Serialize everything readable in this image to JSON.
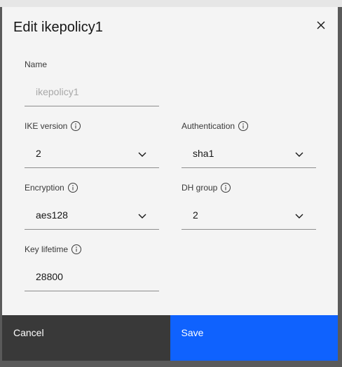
{
  "modal": {
    "title": "Edit ikepolicy1"
  },
  "fields": {
    "name": {
      "label": "Name",
      "placeholder": "ikepolicy1"
    },
    "ike_version": {
      "label": "IKE version",
      "value": "2"
    },
    "authentication": {
      "label": "Authentication",
      "value": "sha1"
    },
    "encryption": {
      "label": "Encryption",
      "value": "aes128"
    },
    "dh_group": {
      "label": "DH group",
      "value": "2"
    },
    "key_lifetime": {
      "label": "Key lifetime",
      "value": "28800"
    }
  },
  "footer": {
    "cancel_label": "Cancel",
    "save_label": "Save"
  },
  "colors": {
    "primary": "#0f62fe",
    "secondary": "#393939",
    "surface": "#f4f4f4"
  },
  "icons": {
    "close": "close-icon",
    "info": "information-icon",
    "dropdown": "chevron-down-icon"
  }
}
